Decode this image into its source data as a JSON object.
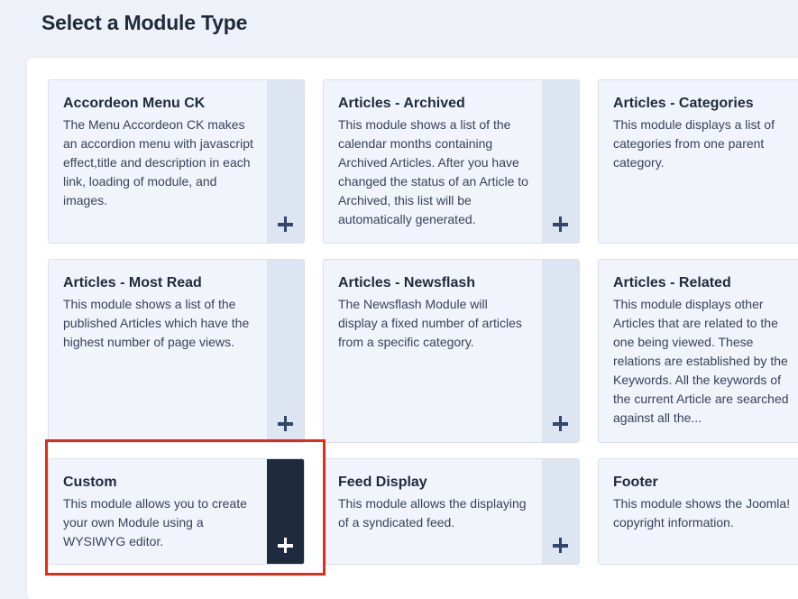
{
  "page": {
    "title": "Select a Module Type"
  },
  "modules": [
    {
      "title": "Accordeon Menu CK",
      "description": "The Menu Accordeon CK makes an accordion menu with javascript effect,title and description in each link, loading of module, and images."
    },
    {
      "title": "Articles - Archived",
      "description": "This module shows a list of the calendar months containing Archived Articles. After you have changed the status of an Article to Archived, this list will be automatically generated."
    },
    {
      "title": "Articles - Categories",
      "description": "This module displays a list of categories from one parent category."
    },
    {
      "title": "Articles - Most Read",
      "description": "This module shows a list of the published Articles which have the highest number of page views."
    },
    {
      "title": "Articles - Newsflash",
      "description": "The Newsflash Module will display a fixed number of articles from a specific category."
    },
    {
      "title": "Articles - Related",
      "description": "This module displays other Articles that are related to the one being viewed. These relations are established by the Keywords. All the keywords of the current Article are searched against all the..."
    },
    {
      "title": "Custom",
      "description": "This module allows you to create your own Module using a WYSIWYG editor."
    },
    {
      "title": "Feed Display",
      "description": "This module allows the displaying of a syndicated feed."
    },
    {
      "title": "Footer",
      "description": "This module shows the Joomla! copyright information."
    }
  ],
  "colors": {
    "card_bg": "#f1f4fb",
    "strip_bg": "#dde4f2",
    "strip_active_bg": "#1e2a3e",
    "highlight": "#e62a18"
  },
  "icons": {
    "add": "plus-icon"
  }
}
